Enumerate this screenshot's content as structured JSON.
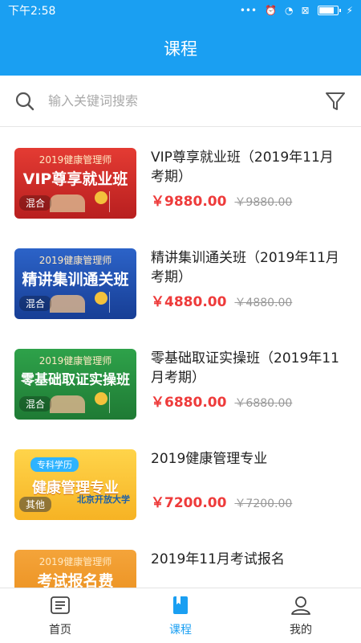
{
  "status": {
    "time": "下午2:58",
    "icons": [
      "dots-icon",
      "alarm-icon",
      "wifi-icon",
      "sim-icon",
      "battery-icon",
      "charging-icon"
    ],
    "battery_level": 0.85
  },
  "header": {
    "title": "课程"
  },
  "search": {
    "placeholder": "输入关键词搜索",
    "value": ""
  },
  "courses": [
    {
      "title": "VIP尊享就业班（2019年11月考期）",
      "price": "￥9880.00",
      "old_price": "￥9880.00",
      "thumb_top": "2019健康管理师",
      "thumb_main": "VIP尊享就业班",
      "thumb_tag": "混合",
      "color": "#d7302b"
    },
    {
      "title": "精讲集训通关班（2019年11月考期）",
      "price": "￥4880.00",
      "old_price": "￥4880.00",
      "thumb_top": "2019健康管理师",
      "thumb_main": "精讲集训通关班",
      "thumb_tag": "混合",
      "color": "#2153b5"
    },
    {
      "title": "零基础取证实操班（2019年11月考期）",
      "price": "￥6880.00",
      "old_price": "￥6880.00",
      "thumb_top": "2019健康管理师",
      "thumb_main": "零基础取证实操班",
      "thumb_tag": "混合",
      "color": "#27903f"
    },
    {
      "title": "2019健康管理专业",
      "price": "￥7200.00",
      "old_price": "￥7200.00",
      "thumb_chip": "专科学历",
      "thumb_main": "健康管理专业",
      "thumb_tag": "其他",
      "thumb_school": "北京开放大学",
      "color": "#f8c12f"
    },
    {
      "title": "2019年11月考试报名",
      "thumb_top": "2019健康管理师",
      "thumb_main": "考试报名费",
      "color": "#ef9b2a"
    }
  ],
  "tabbar": {
    "items": [
      {
        "label": "首页",
        "icon": "home-list-icon",
        "active": false
      },
      {
        "label": "课程",
        "icon": "book-icon",
        "active": true
      },
      {
        "label": "我的",
        "icon": "user-icon",
        "active": false
      }
    ],
    "accent": "#1a9ff2"
  },
  "colors": {
    "primary": "#1a9ff2",
    "price": "#ee3b3b"
  }
}
